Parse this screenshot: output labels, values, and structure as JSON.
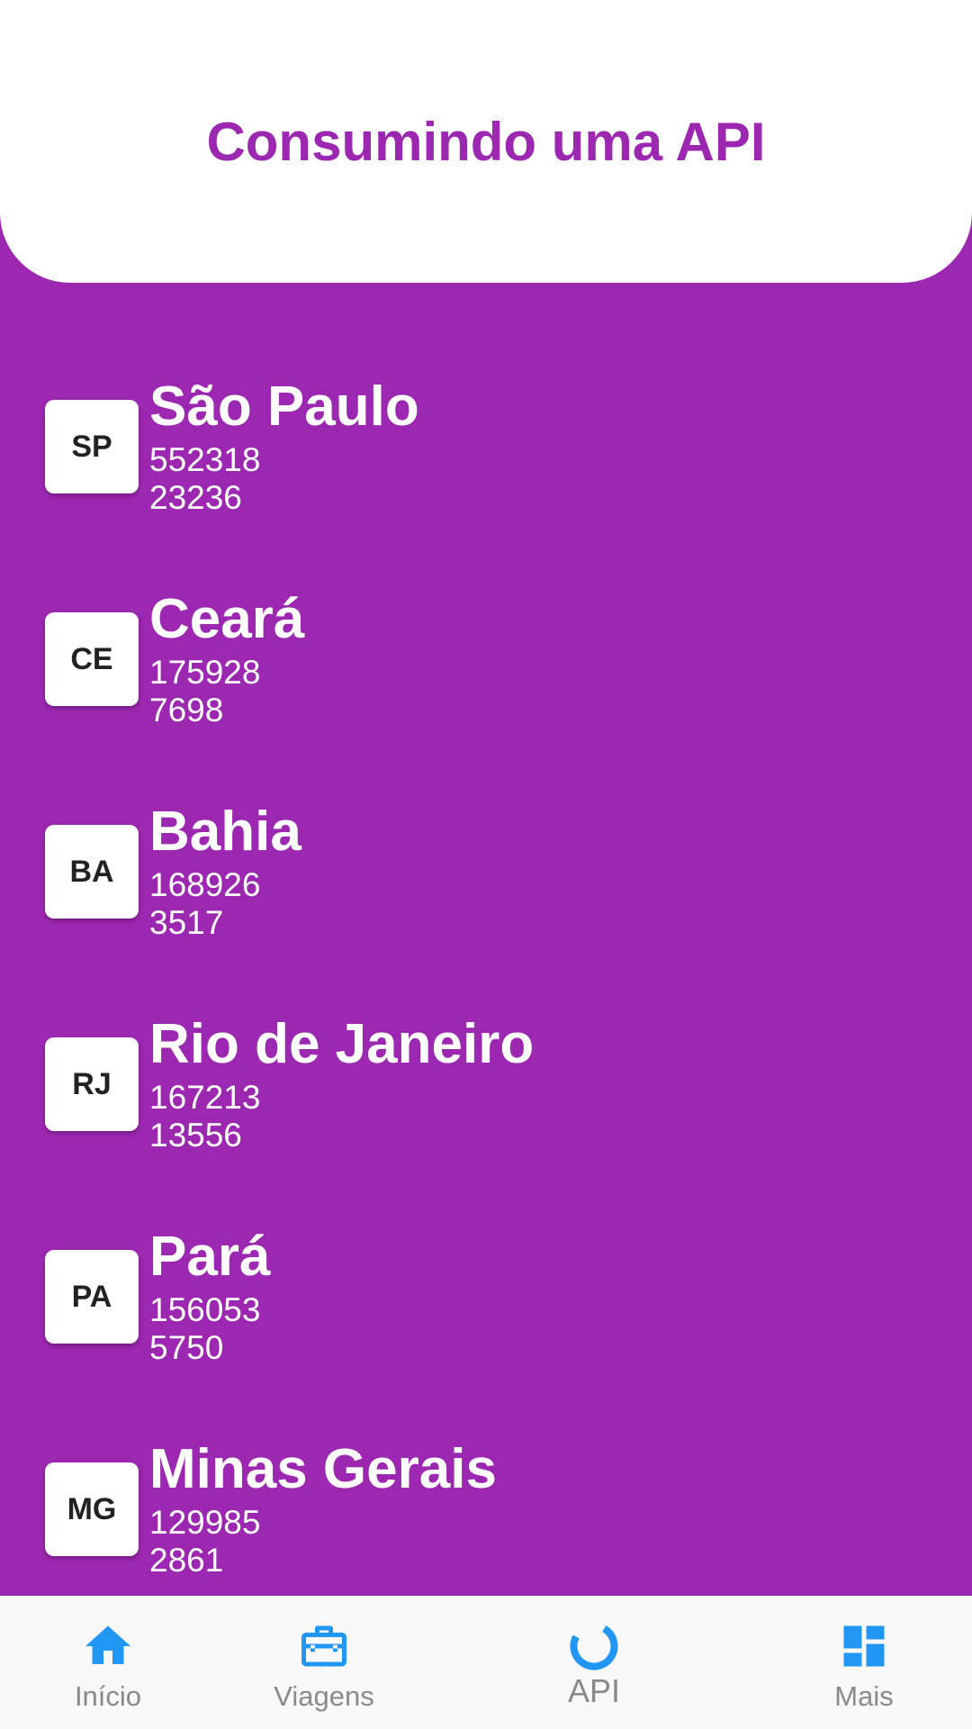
{
  "header": {
    "title": "Consumindo uma API"
  },
  "states": [
    {
      "uf": "SP",
      "name": "São Paulo",
      "cases": "552318",
      "deaths": "23236"
    },
    {
      "uf": "CE",
      "name": "Ceará",
      "cases": "175928",
      "deaths": "7698"
    },
    {
      "uf": "BA",
      "name": "Bahia",
      "cases": "168926",
      "deaths": "3517"
    },
    {
      "uf": "RJ",
      "name": "Rio de Janeiro",
      "cases": "167213",
      "deaths": "13556"
    },
    {
      "uf": "PA",
      "name": "Pará",
      "cases": "156053",
      "deaths": "5750"
    },
    {
      "uf": "MG",
      "name": "Minas Gerais",
      "cases": "129985",
      "deaths": "2861"
    }
  ],
  "bottom_nav": {
    "items": [
      {
        "label": "Início",
        "icon": "home-icon"
      },
      {
        "label": "Viagens",
        "icon": "briefcase-icon"
      },
      {
        "label": "API",
        "icon": "loading-ring-icon",
        "selected": true
      },
      {
        "label": "Mais",
        "icon": "dashboard-icon"
      }
    ]
  },
  "colors": {
    "primary": "#9C27B0",
    "nav_icon": "#2196F3",
    "nav_label": "#8A8A8A",
    "nav_background": "#F8F8F8"
  }
}
